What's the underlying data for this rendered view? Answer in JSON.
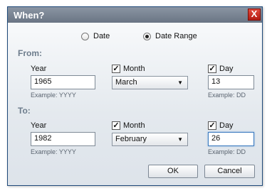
{
  "dialog": {
    "title": "When?",
    "close_glyph": "X"
  },
  "mode": {
    "options": [
      "Date",
      "Date Range"
    ],
    "selected": "Date Range"
  },
  "from": {
    "section_label": "From:",
    "year_label": "Year",
    "year_value": "1965",
    "year_example": "Example: YYYY",
    "month_label": "Month",
    "month_checked": true,
    "month_value": "March",
    "day_label": "Day",
    "day_checked": true,
    "day_value": "13",
    "day_example": "Example: DD"
  },
  "to": {
    "section_label": "To:",
    "year_label": "Year",
    "year_value": "1982",
    "year_example": "Example: YYYY",
    "month_label": "Month",
    "month_checked": true,
    "month_value": "February",
    "day_label": "Day",
    "day_checked": true,
    "day_value": "26",
    "day_example": "Example: DD"
  },
  "buttons": {
    "ok": "OK",
    "cancel": "Cancel"
  },
  "glyphs": {
    "check": "✓",
    "dropdown": "▼"
  },
  "colors": {
    "close_button": "#c62a1f",
    "section_label": "#6d7c8c",
    "focus": "#3d7bbf"
  }
}
